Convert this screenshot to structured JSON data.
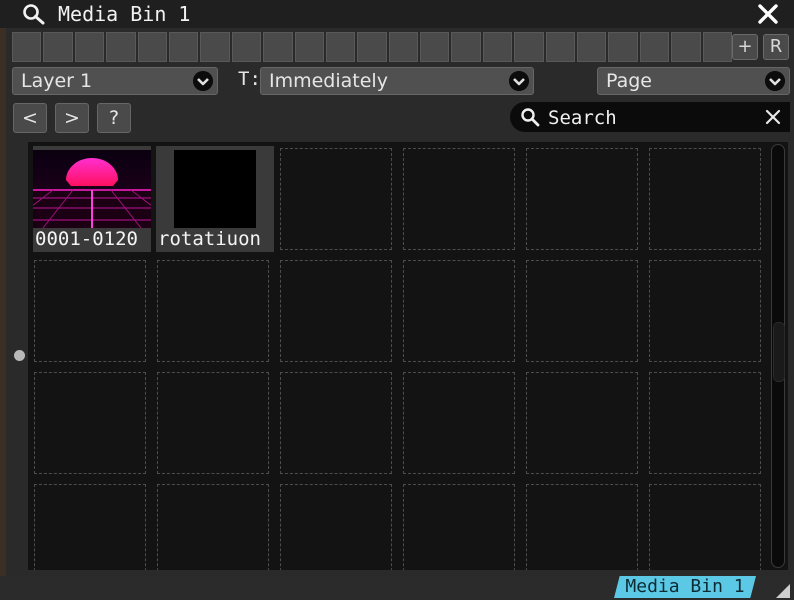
{
  "window": {
    "title": "Media Bin 1",
    "close_icon": "close-icon",
    "title_icon": "search-icon"
  },
  "tab_strip": {
    "cell_count": 23,
    "add_label": "+",
    "reset_label": "R"
  },
  "controls": {
    "layer_select": {
      "value": "Layer 1"
    },
    "transition_label": "T:",
    "transition_select": {
      "value": "Immediately"
    },
    "page_select": {
      "value": "Page"
    }
  },
  "nav": {
    "prev_label": "<",
    "next_label": ">",
    "help_label": "?"
  },
  "search": {
    "placeholder": "Search",
    "value": ""
  },
  "media": [
    {
      "label": "0001-0120",
      "thumbnail": "synthwave-sunset"
    },
    {
      "label": "rotatiuon",
      "thumbnail": "black"
    }
  ],
  "grid": {
    "columns": 6,
    "rows": 4
  },
  "footer": {
    "tab_label": "Media Bin 1"
  },
  "colors": {
    "accent_tab": "#5bc8e6",
    "background": "#1e1e1e",
    "grid_bg": "#131313",
    "thumb_magenta": "#ff1fb4"
  }
}
